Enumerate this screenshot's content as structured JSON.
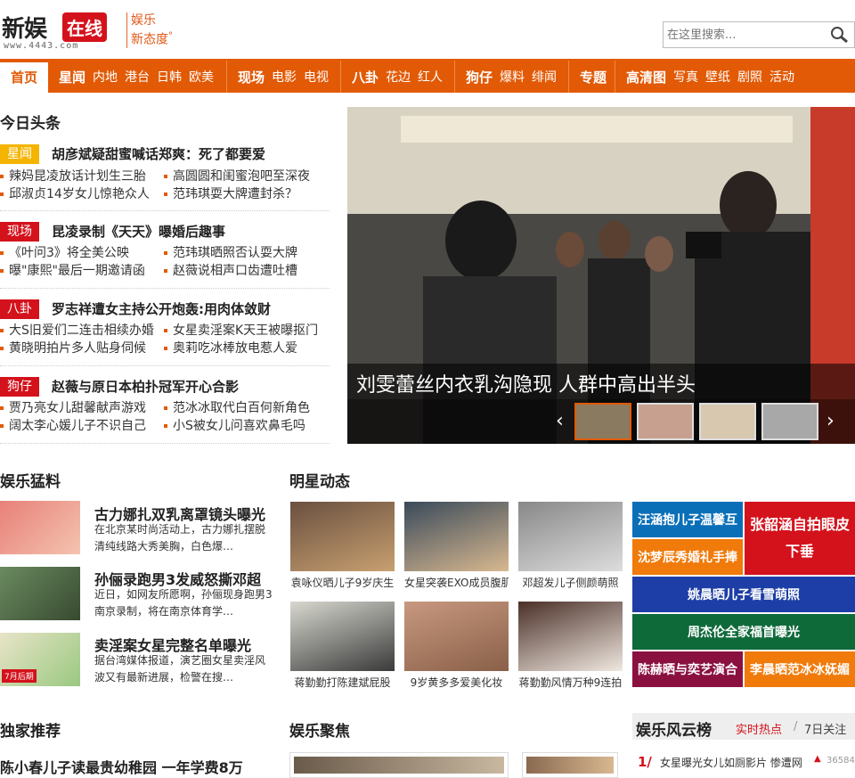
{
  "header": {
    "logo_main": "新娱",
    "logo_badge": "在线",
    "logo_url": "www.4443.com",
    "slogan_line1": "娱乐",
    "slogan_line2": "新态度",
    "slogan_mark": "°",
    "search_placeholder": "在这里搜索..."
  },
  "nav": {
    "home": "首页",
    "groups": [
      {
        "main": "星闻",
        "items": [
          "内地",
          "港台",
          "日韩",
          "欧美"
        ]
      },
      {
        "main": "现场",
        "items": [
          "电影",
          "电视"
        ]
      },
      {
        "main": "八卦",
        "items": [
          "花边",
          "红人"
        ]
      },
      {
        "main": "狗仔",
        "items": [
          "爆料",
          "绯闻"
        ]
      },
      {
        "main": "专题",
        "items": []
      },
      {
        "main": "高清图",
        "items": [
          "写真",
          "壁纸",
          "剧照",
          "活动"
        ]
      }
    ]
  },
  "headlines": {
    "title": "今日头条",
    "blocks": [
      {
        "cat": "星闻",
        "head": "胡彦斌疑甜蜜喊话郑爽：死了都要爱",
        "subs": [
          "辣妈昆凌放话计划生三胎",
          "高圆圆和闺蜜泡吧至深夜",
          "邱淑贞14岁女儿惊艳众人",
          "范玮琪耍大牌遭封杀？"
        ]
      },
      {
        "cat": "现场",
        "head": "昆凌录制《天天》曝婚后趣事",
        "subs": [
          "《叶问3》将全美公映",
          "范玮琪晒照否认耍大牌",
          "曝\"康熙\"最后一期邀请函",
          "赵薇说相声口齿遭吐槽"
        ]
      },
      {
        "cat": "八卦",
        "head": "罗志祥遭女主持公开炮轰:用肉体敛财",
        "subs": [
          "大S旧爱们二连击相续办婚",
          "女星卖淫案K天王被曝抠门",
          "黄晓明拍片多人贴身伺候",
          "奥莉吃冰棒放电惹人爱"
        ]
      },
      {
        "cat": "狗仔",
        "head": "赵薇与原日本柏扑冠军开心合影",
        "subs": [
          "贾乃亮女儿甜馨献声游戏",
          "范冰冰取代白百何新角色",
          "阔太李心媛儿子不识自己",
          "小S被女儿问喜欢鼻毛吗"
        ]
      }
    ]
  },
  "slider": {
    "caption": "刘雯蕾丝内衣乳沟隐现 人群中高出半头",
    "prev": "‹",
    "next": "›"
  },
  "gossip": {
    "title": "娱乐猛料",
    "items": [
      {
        "title": "古力娜扎双乳离罩镜头曝光",
        "desc": "在北京某时尚活动上，古力娜扎摆脱清纯线路大秀美胸，白色爆…"
      },
      {
        "title": "孙俪录跑男3发威怒撕邓超",
        "desc": "近日，如网友所愿啊，孙俪现身跑男3南京录制，将在南京体育学…"
      },
      {
        "title": "卖淫案女星完整名单曝光",
        "desc": "据台湾媒体报道，演艺圈女星卖淫风波又有最新进展，检警在搜…"
      }
    ],
    "badge_text": "7月后期"
  },
  "stars": {
    "title": "明星动态",
    "photos": [
      "袁咏仪晒儿子9岁庆生",
      "女星突袭EXO成员腹肌",
      "邓超发儿子侧颜萌照",
      "蒋勤勤打陈建斌屁股",
      "9岁黄多多爱美化妆",
      "蒋勤勤风情万种9连拍"
    ]
  },
  "tiles": [
    {
      "text": "汪涵抱儿子温馨互",
      "color": "#0b6fb8"
    },
    {
      "text": "张韶涵自拍眼皮下垂",
      "color": "#d4121c"
    },
    {
      "text": "沈梦辰秀婚礼手捧",
      "color": "#f07a0a"
    },
    {
      "text": "姚晨晒儿子看雪萌照",
      "color": "#1d3ea6"
    },
    {
      "text": "周杰伦全家福首曝光",
      "color": "#0f6a3a"
    },
    {
      "text": "陈赫晒与奕艺演合",
      "color": "#8a1040"
    },
    {
      "text": "李晨晒范冰冰妩媚",
      "color": "#f07a0a"
    }
  ],
  "exclusive": {
    "title": "独家推荐",
    "head": "陈小春儿子读最贵幼稚园 一年学费8万"
  },
  "focus": {
    "title": "娱乐聚焦"
  },
  "ranking": {
    "title": "娱乐风云榜",
    "tab1": "实时热点",
    "sep": "/",
    "tab2": "7日关注",
    "first_rank": "1/",
    "first_text": "女星曝光女儿如厕影片 惨遭网",
    "first_count": "36584"
  },
  "colors": {
    "accent": "#e25a06",
    "red": "#d4121c",
    "yellow": "#f4b400"
  }
}
